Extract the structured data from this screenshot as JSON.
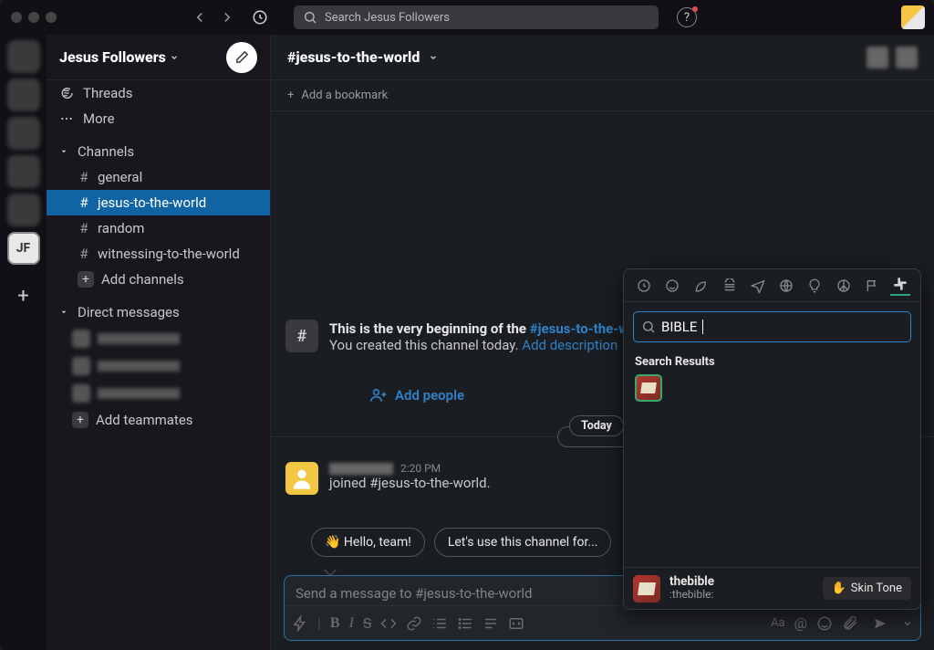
{
  "titlebar": {
    "search_placeholder": "Search Jesus Followers"
  },
  "rail": {
    "jf": "JF"
  },
  "sidebar": {
    "workspace": "Jesus Followers",
    "threads": "Threads",
    "more": "More",
    "channels_label": "Channels",
    "channels": [
      {
        "name": "general"
      },
      {
        "name": "jesus-to-the-world",
        "active": true
      },
      {
        "name": "random"
      },
      {
        "name": "witnessing-to-the-world"
      }
    ],
    "add_channels": "Add channels",
    "dm_label": "Direct messages",
    "add_teammates": "Add teammates"
  },
  "channel": {
    "title": "#jesus-to-the-world",
    "add_bookmark": "Add a bookmark",
    "intro_prefix": "This is the very beginning of the ",
    "intro_link": "#jesus-to-the-wo",
    "intro_line2a": "You created this channel today. ",
    "intro_line2b": "Add description",
    "add_people": "Add people",
    "divider": "Today",
    "msg_time": "2:20 PM",
    "msg_text": "joined #jesus-to-the-world.",
    "sugg1": "👋 Hello, team!",
    "sugg2": "Let's use this channel for...",
    "composer_placeholder": "Send a message to #jesus-to-the-world"
  },
  "emoji": {
    "search_value": "BIBLE",
    "results_label": "Search Results",
    "footer_name": "thebible",
    "footer_code": ":thebible:",
    "skin": "Skin Tone"
  }
}
